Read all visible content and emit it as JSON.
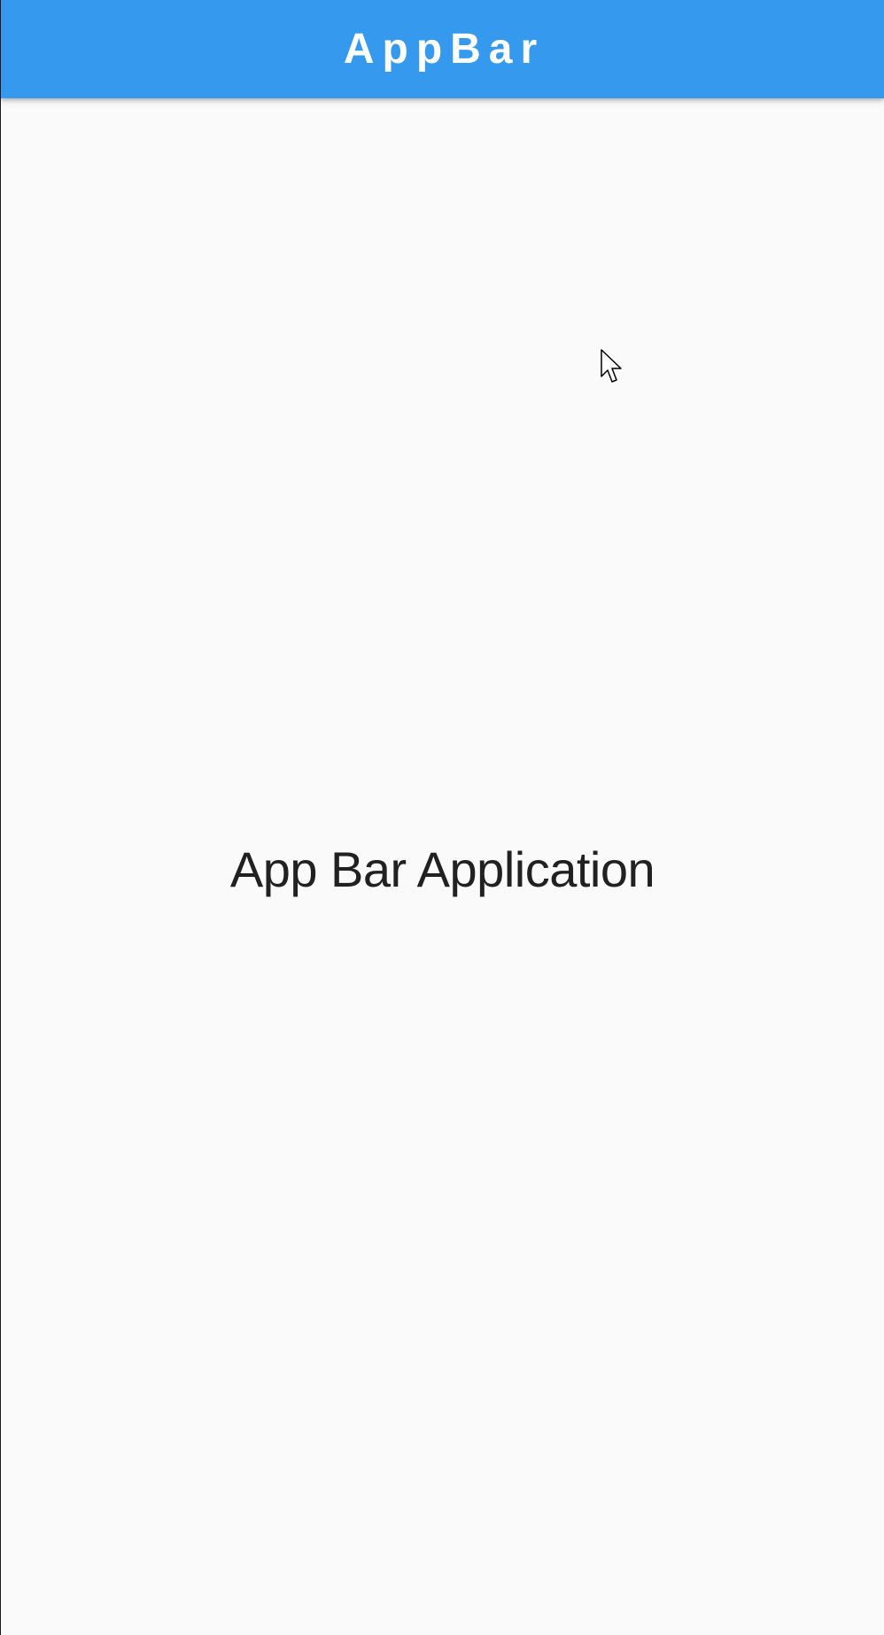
{
  "app_bar": {
    "title": "AppBar",
    "background_color": "#3599ee",
    "title_color": "#ffffff"
  },
  "body": {
    "message": "App Bar Application",
    "background_color": "#fafafa",
    "text_color": "#212121"
  },
  "cursor": {
    "icon": "mouse-pointer-icon"
  }
}
